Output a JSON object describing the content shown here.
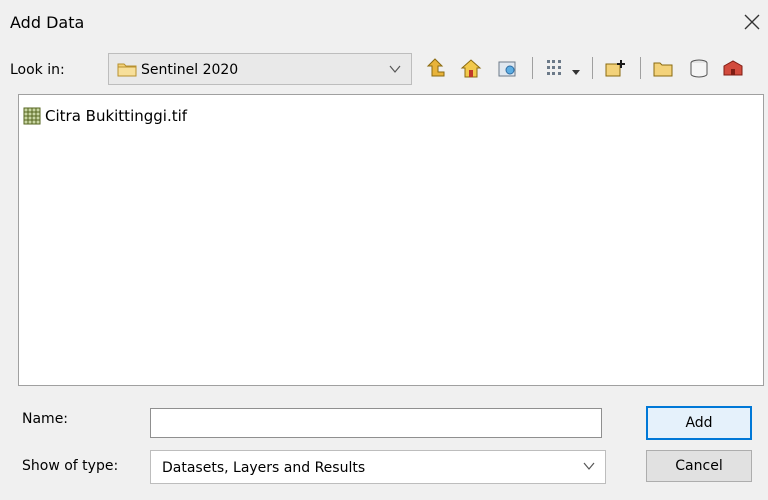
{
  "window": {
    "title": "Add Data",
    "close_icon": "close-icon"
  },
  "lookin": {
    "label": "Look in:",
    "value": "Sentinel 2020",
    "folder_icon": "folder-icon",
    "dropdown_icon": "chevron-down-icon"
  },
  "toolbar": {
    "icons": [
      "up-one-level-icon",
      "home-icon",
      "connect-folder-icon",
      "view-list-icon",
      "view-options-dropdown-icon",
      "new-layer-icon",
      "new-folder-icon",
      "new-database-icon",
      "toolbox-icon"
    ]
  },
  "files": [
    {
      "name": "Citra Bukittinggi.tif",
      "icon": "raster-dataset-icon"
    }
  ],
  "name_field": {
    "label": "Name:",
    "value": ""
  },
  "type_field": {
    "label": "Show of type:",
    "value": "Datasets, Layers and Results"
  },
  "buttons": {
    "add": "Add",
    "cancel": "Cancel"
  },
  "colors": {
    "default_button_border": "#0078d7",
    "background": "#f0f0f0"
  }
}
